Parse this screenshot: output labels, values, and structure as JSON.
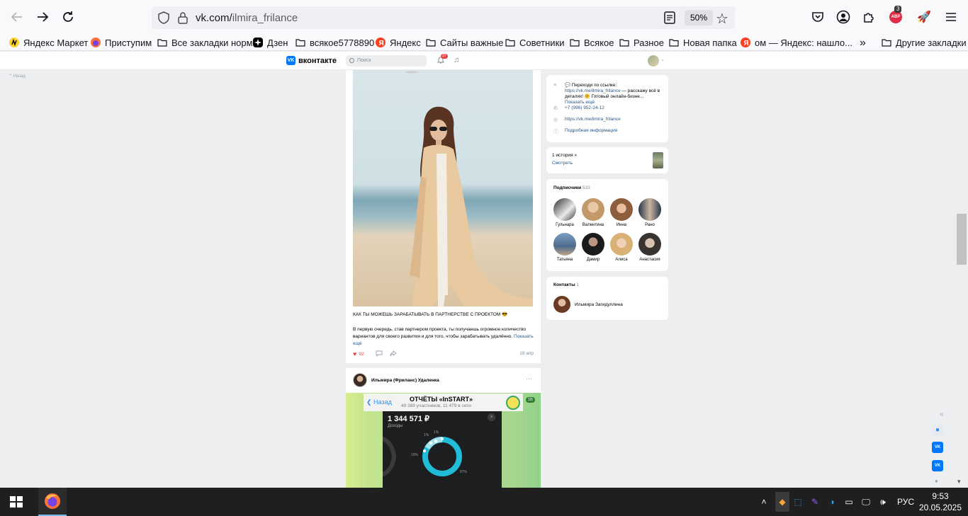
{
  "browser": {
    "url_host": "vk.com/",
    "url_path": "ilmira_frilance",
    "zoom": "50%",
    "extension_badge_count": "3",
    "abp_badge": "АВР"
  },
  "bookmarks": [
    {
      "label": "Яндекс Маркет",
      "icon": "yandex-market-icon"
    },
    {
      "label": "Приступим",
      "icon": "firefox-icon"
    },
    {
      "label": "Все закладки норм",
      "icon": "folder-icon"
    },
    {
      "label": "Дзен",
      "icon": "zen-icon"
    },
    {
      "label": "всякое5778890",
      "icon": "folder-icon"
    },
    {
      "label": "Яндекс",
      "icon": "yandex-icon"
    },
    {
      "label": "Сайты важные",
      "icon": "folder-icon"
    },
    {
      "label": "Советники",
      "icon": "folder-icon"
    },
    {
      "label": "Всякое",
      "icon": "folder-icon"
    },
    {
      "label": "Разное",
      "icon": "folder-icon"
    },
    {
      "label": "Новая папка",
      "icon": "folder-icon"
    },
    {
      "label": "ом — Яндекс: нашло...",
      "icon": "yandex-icon"
    }
  ],
  "bookmarks_other": "Другие закладки",
  "vk": {
    "logo_text": "вконтакте",
    "search_placeholder": "Поиск",
    "notifications_count": "27",
    "back_label": "Назад"
  },
  "post": {
    "title": "КАК ТЫ МОЖЕШЬ ЗАРАБАТЫВАТЬ В ПАРТНЕРСТВЕ С ПРОЕКТОМ 😎",
    "body": "В первую очередь, став партнером проекта, ты получаешь огромное количество вариантов для своего развития и для того, чтобы зарабатывать удалённо.",
    "show_more": "Показать ещё",
    "likes": "92",
    "date": "19 апр"
  },
  "post2": {
    "author": "Ильмира (Фриланс) Удаленка",
    "tg_back": "Назад",
    "tg_title": "ОТЧЁТЫ «InSTART»",
    "tg_subtitle": "49 389 участников, 11 479 в сети",
    "tg_counter": "1/5",
    "tg_amount": "1 344 571 ₽",
    "tg_amount_label": "Доходы",
    "donut_labels": [
      "1%",
      "1%",
      "10%",
      "87%"
    ]
  },
  "profile_info": {
    "status_prefix": "💬 Переходи по ссылке: ",
    "status_link": "https://vk.me/ilmira_frilance",
    "status_suffix": " — расскажу всё в деталях! 🤗 Готовый онлайн-бизне...",
    "status_more": "Показать ещё",
    "phone": "+7 (996) 952-24-12",
    "site": "https://vk.me/ilmira_frilance",
    "details": "Подробная информация"
  },
  "stories": {
    "count": "1 история »",
    "watch": "Смотреть"
  },
  "subscribers": {
    "title": "Подписчики",
    "count": "533",
    "people": [
      {
        "name": "Гульнара"
      },
      {
        "name": "Валентина"
      },
      {
        "name": "Инна"
      },
      {
        "name": "Рано"
      },
      {
        "name": "Татьяна"
      },
      {
        "name": "Дамир"
      },
      {
        "name": "Алиса"
      },
      {
        "name": "Анастасия"
      }
    ]
  },
  "contacts": {
    "title": "Контакты",
    "count": "1",
    "name": "Ильмира Загидуллина"
  },
  "taskbar": {
    "lang": "РУС",
    "time": "9:53",
    "date": "20.05.2025"
  }
}
